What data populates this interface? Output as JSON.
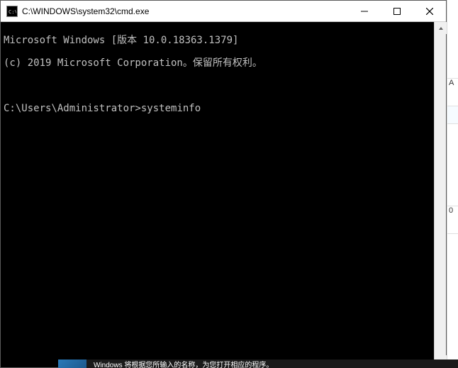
{
  "window": {
    "title": "C:\\WINDOWS\\system32\\cmd.exe"
  },
  "console": {
    "line1": "Microsoft Windows [版本 10.0.18363.1379]",
    "line2": "(c) 2019 Microsoft Corporation。保留所有权利。",
    "prompt": "C:\\Users\\Administrator>",
    "command": "systeminfo"
  },
  "background": {
    "hint1": "A",
    "hint2": "0",
    "bottom_text": "Windows 将根据您所输入的名称，为您打开相应的程序。"
  }
}
